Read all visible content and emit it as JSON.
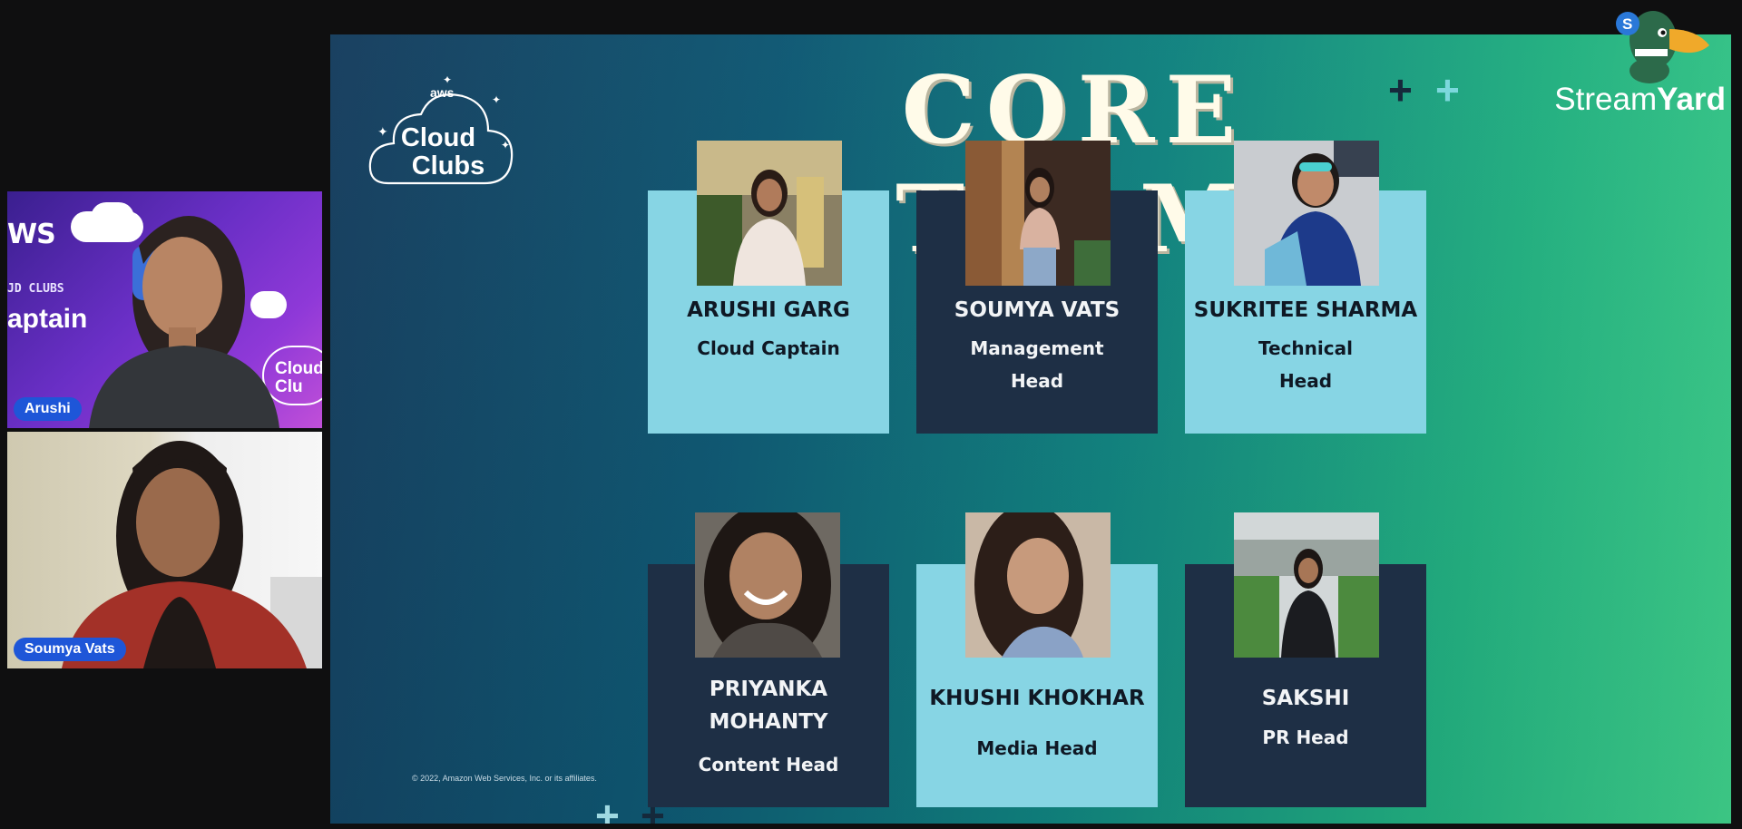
{
  "participants": [
    {
      "name": "Arushi",
      "background": {
        "aws": "WS",
        "clubs": "JD CLUBS",
        "captain": "aptain",
        "cloud_logo": "Cloud Clu"
      }
    },
    {
      "name": "Soumya Vats"
    }
  ],
  "slide": {
    "logo": {
      "aws": "aws",
      "line1": "Cloud",
      "line2": "Clubs"
    },
    "title": "CORE TEAM",
    "team": [
      {
        "name": "ARUSHI GARG",
        "role": "Cloud Captain"
      },
      {
        "name": "SOUMYA VATS",
        "role_line1": "Management",
        "role_line2": "Head"
      },
      {
        "name": "SUKRITEE SHARMA",
        "role_line1": "Technical",
        "role_line2": "Head"
      },
      {
        "name_line1": "PRIYANKA",
        "name_line2": "MOHANTY",
        "role": "Content Head"
      },
      {
        "name": "KHUSHI KHOKHAR",
        "role": "Media Head"
      },
      {
        "name": "SAKSHI",
        "role": "PR Head"
      }
    ],
    "copyright": "© 2022, Amazon Web Services, Inc. or its affiliates."
  },
  "brand": {
    "part1": "Stream",
    "part2": "Yard",
    "badge": "S"
  },
  "colors": {
    "card_light": "#87d5e4",
    "card_dark": "#1e2f45",
    "name_pill": "#1e56d8"
  },
  "icons": [
    "plus-icon",
    "streamyard-duck-icon",
    "cloud-icon"
  ]
}
